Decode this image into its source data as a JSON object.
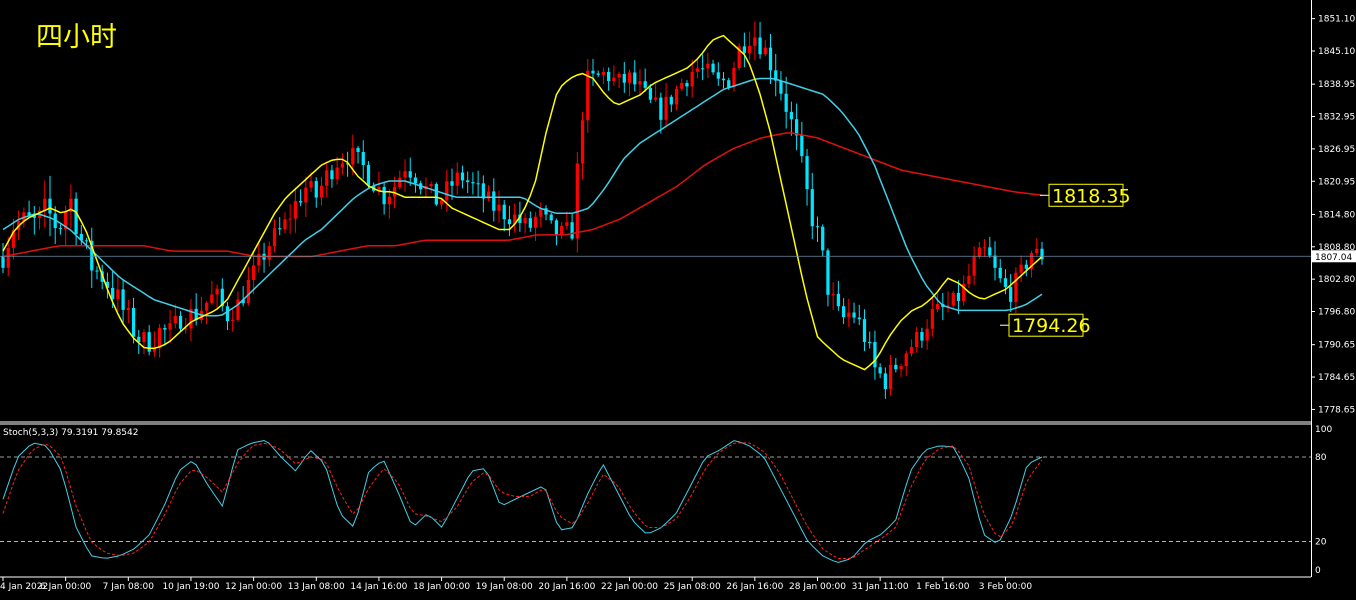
{
  "title": "四小时",
  "colors": {
    "background": "#000000",
    "frame": "#ffffff",
    "bull": "#ff0000",
    "bear": "#00e5ff",
    "ma_fast": "#ffff00",
    "ma_mid": "#40d0e8",
    "ma_slow": "#e01010",
    "stoch_main": "#40d0e8",
    "stoch_signal": "#ff2020",
    "label_bg": "#000000",
    "label_border": "#ffff00",
    "label_text": "#ffff00",
    "title_color": "#ffff00"
  },
  "price_labels": [
    {
      "value": 1818.35,
      "text": "1818.35"
    },
    {
      "value": 1794.26,
      "text": "1794.26"
    }
  ],
  "current_price": {
    "value": 1807.04,
    "text": "1807.04"
  },
  "stoch_header": "Stoch(5,3,3) 79.3191 79.8542",
  "chart_data": [
    {
      "type": "candlestick",
      "title": "四小时",
      "ylim": [
        1776.5,
        1854
      ],
      "y_ticks": [
        "1851.10",
        "1845.10",
        "1838.95",
        "1832.95",
        "1826.95",
        "1820.95",
        "1814.80",
        "1808.80",
        "1802.80",
        "1796.80",
        "1790.65",
        "1784.65",
        "1778.65"
      ],
      "y_tick_values": [
        1851.1,
        1845.1,
        1838.95,
        1832.95,
        1826.95,
        1820.95,
        1814.8,
        1808.8,
        1802.8,
        1796.8,
        1790.65,
        1784.65,
        1778.65
      ],
      "x_tick_labels": [
        "4 Jan 2022",
        "6 Jan 00:00",
        "7 Jan 08:00",
        "10 Jan 19:00",
        "12 Jan 00:00",
        "13 Jan 08:00",
        "14 Jan 16:00",
        "18 Jan 00:00",
        "19 Jan 08:00",
        "20 Jan 16:00",
        "22 Jan 00:00",
        "25 Jan 08:00",
        "26 Jan 16:00",
        "28 Jan 00:00",
        "31 Jan 11:00",
        "1 Feb 16:00",
        "3 Feb 00:00"
      ],
      "x_tick_index": [
        0,
        12,
        24,
        36,
        48,
        60,
        72,
        84,
        96,
        108,
        120,
        132,
        144,
        156,
        168,
        180,
        192
      ],
      "close_path": [
        1807,
        1813,
        1814,
        1813,
        1815,
        1812,
        1818,
        1810,
        1805,
        1803,
        1800,
        1796,
        1792,
        1791,
        1793,
        1793,
        1796,
        1796,
        1798,
        1800,
        1796,
        1798,
        1802,
        1806,
        1810,
        1812,
        1816,
        1820,
        1818,
        1822,
        1825,
        1826,
        1824,
        1822,
        1818,
        1820,
        1824,
        1822,
        1819,
        1817,
        1820,
        1822,
        1820,
        1818,
        1816,
        1815,
        1814,
        1812,
        1815,
        1812,
        1811,
        1812,
        1838,
        1840,
        1841,
        1839,
        1840,
        1838,
        1835,
        1834,
        1837,
        1840,
        1842,
        1841,
        1839,
        1840,
        1846,
        1849,
        1846,
        1842,
        1836,
        1828,
        1818,
        1810,
        1800,
        1795,
        1797,
        1793,
        1786,
        1784,
        1787,
        1790,
        1792,
        1796,
        1797,
        1798,
        1801,
        1806,
        1808,
        1803,
        1800,
        1803,
        1808,
        1807
      ],
      "volatility": [
        3,
        3,
        3,
        4,
        6,
        3,
        4,
        4,
        4,
        3,
        4,
        4,
        3,
        3,
        4,
        3,
        3,
        4,
        3,
        3,
        3,
        3,
        3,
        3,
        3,
        3,
        3,
        4,
        3,
        3,
        3,
        3,
        3,
        4,
        3,
        3,
        3,
        3,
        3,
        3,
        3,
        3,
        3,
        3,
        3,
        3,
        3,
        3,
        3,
        3,
        3,
        3,
        5,
        3,
        3,
        3,
        3,
        3,
        3,
        3,
        3,
        3,
        3,
        3,
        3,
        3,
        3,
        4,
        3,
        4,
        4,
        4,
        4,
        4,
        4,
        3,
        4,
        3,
        4,
        3,
        3,
        3,
        3,
        3,
        3,
        3,
        3,
        3,
        3,
        3,
        3,
        3,
        3,
        2
      ],
      "ma_fast": [
        1808,
        1812,
        1814,
        1815,
        1816,
        1815,
        1816,
        1812,
        1806,
        1800,
        1795,
        1792,
        1790,
        1790,
        1791,
        1793,
        1795,
        1796,
        1797,
        1799,
        1803,
        1807,
        1811,
        1815,
        1818,
        1820,
        1822,
        1824,
        1825,
        1825,
        1822,
        1820,
        1819,
        1819,
        1818,
        1818,
        1818,
        1818,
        1816,
        1815,
        1814,
        1813,
        1812,
        1812,
        1815,
        1820,
        1830,
        1838,
        1840,
        1841,
        1840,
        1837,
        1835,
        1836,
        1837,
        1839,
        1840,
        1841,
        1842,
        1844,
        1847,
        1848,
        1846,
        1844,
        1838,
        1830,
        1820,
        1810,
        1800,
        1792,
        1790,
        1788,
        1787,
        1786,
        1788,
        1792,
        1795,
        1797,
        1798,
        1800,
        1803,
        1802,
        1800,
        1799,
        1800,
        1801,
        1803,
        1805,
        1807
      ],
      "ma_mid": [
        1812,
        1814,
        1815,
        1814,
        1812,
        1809,
        1806,
        1803,
        1801,
        1799,
        1798,
        1797,
        1796,
        1796,
        1798,
        1801,
        1804,
        1807,
        1810,
        1812,
        1815,
        1818,
        1820,
        1821,
        1821,
        1820,
        1819,
        1818,
        1818,
        1818,
        1818,
        1818,
        1816,
        1815,
        1815,
        1816,
        1820,
        1825,
        1828,
        1830,
        1832,
        1834,
        1836,
        1838,
        1839,
        1840,
        1840,
        1839,
        1838,
        1837,
        1834,
        1830,
        1824,
        1816,
        1808,
        1802,
        1798,
        1797,
        1797,
        1797,
        1797,
        1798,
        1800
      ],
      "ma_slow": [
        1807,
        1808,
        1809,
        1809,
        1809,
        1809,
        1808,
        1808,
        1808,
        1807,
        1807,
        1807,
        1808,
        1809,
        1809,
        1810,
        1810,
        1810,
        1810,
        1811,
        1811,
        1812,
        1814,
        1817,
        1820,
        1824,
        1827,
        1829,
        1830,
        1829,
        1827,
        1825,
        1823,
        1822,
        1821,
        1820,
        1819,
        1818.35
      ]
    },
    {
      "type": "line",
      "title": "Stoch(5,3,3) 79.3191 79.8542",
      "ylim": [
        -3,
        102
      ],
      "y_ticks": [
        "100",
        "80",
        "20",
        "0"
      ],
      "y_tick_values": [
        100,
        80,
        20,
        0
      ],
      "levels": [
        80,
        20
      ],
      "series": [
        {
          "name": "79.3191",
          "values": [
            50,
            80,
            90,
            88,
            70,
            30,
            10,
            8,
            10,
            15,
            25,
            45,
            70,
            78,
            60,
            45,
            85,
            90,
            92,
            80,
            70,
            85,
            75,
            40,
            30,
            70,
            78,
            55,
            30,
            40,
            30,
            50,
            70,
            72,
            45,
            50,
            55,
            60,
            28,
            30,
            55,
            75,
            55,
            35,
            25,
            30,
            40,
            60,
            80,
            85,
            92,
            88,
            80,
            60,
            40,
            20,
            10,
            5,
            8,
            20,
            25,
            35,
            70,
            85,
            88,
            87,
            65,
            25,
            18,
            40,
            75,
            80
          ]
        },
        {
          "name": "79.8542",
          "values": [
            40,
            70,
            85,
            90,
            80,
            45,
            20,
            12,
            10,
            12,
            20,
            38,
            60,
            72,
            65,
            55,
            75,
            88,
            90,
            85,
            75,
            80,
            78,
            55,
            38,
            58,
            72,
            62,
            40,
            38,
            34,
            44,
            62,
            70,
            55,
            52,
            52,
            58,
            38,
            32,
            48,
            68,
            60,
            42,
            30,
            30,
            36,
            52,
            72,
            84,
            90,
            90,
            84,
            70,
            50,
            30,
            15,
            8,
            8,
            15,
            22,
            30,
            58,
            78,
            86,
            88,
            74,
            40,
            22,
            32,
            64,
            78
          ]
        }
      ]
    }
  ]
}
